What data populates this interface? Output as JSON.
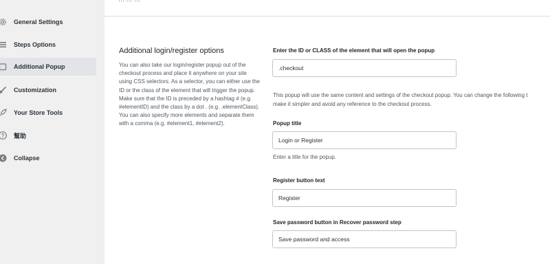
{
  "sidebar": {
    "items": [
      {
        "label": "General Settings",
        "icon": "gear-icon"
      },
      {
        "label": "Steps Options",
        "icon": "list-icon"
      },
      {
        "label": "Additional Popup",
        "icon": "popup-icon",
        "active": true
      },
      {
        "label": "Customization",
        "icon": "brush-icon"
      },
      {
        "label": "Your Store Tools",
        "icon": "rocket-icon"
      },
      {
        "label": "幫助",
        "icon": "help-icon"
      },
      {
        "label": "Collapse",
        "icon": "collapse-icon"
      }
    ]
  },
  "header": {
    "cut_text": "… … …"
  },
  "section": {
    "title": "Additional login/register options",
    "description": "You can also take our login/register popup out of the checkout process and place it anywhere on your site using CSS selectors. As a selector, you can either use the ID or the class of the element that will trigger the popup. Make sure that the ID is preceded by a hashtag # (e.g. #elementID) and the class by a dot . (e.g. .elementClass). You can also specify more elements and separate them with a comma (e.g. #element1, #element2)."
  },
  "fields": {
    "selector": {
      "label": "Enter the ID or CLASS of the element that will open the popup",
      "value": ".checkout"
    },
    "info_line1": "This popup will use the same content and settings of the checkout popup. You can change the following t",
    "info_line2": "make it simpler and avoid any reference to the checkout process.",
    "popup_title": {
      "label": "Popup title",
      "value": "Login or Register",
      "help": "Enter a title for the popup."
    },
    "register_button": {
      "label": "Register button text",
      "value": "Register"
    },
    "save_password": {
      "label": "Save password button in Recover password step",
      "value": "Save password and access"
    }
  }
}
